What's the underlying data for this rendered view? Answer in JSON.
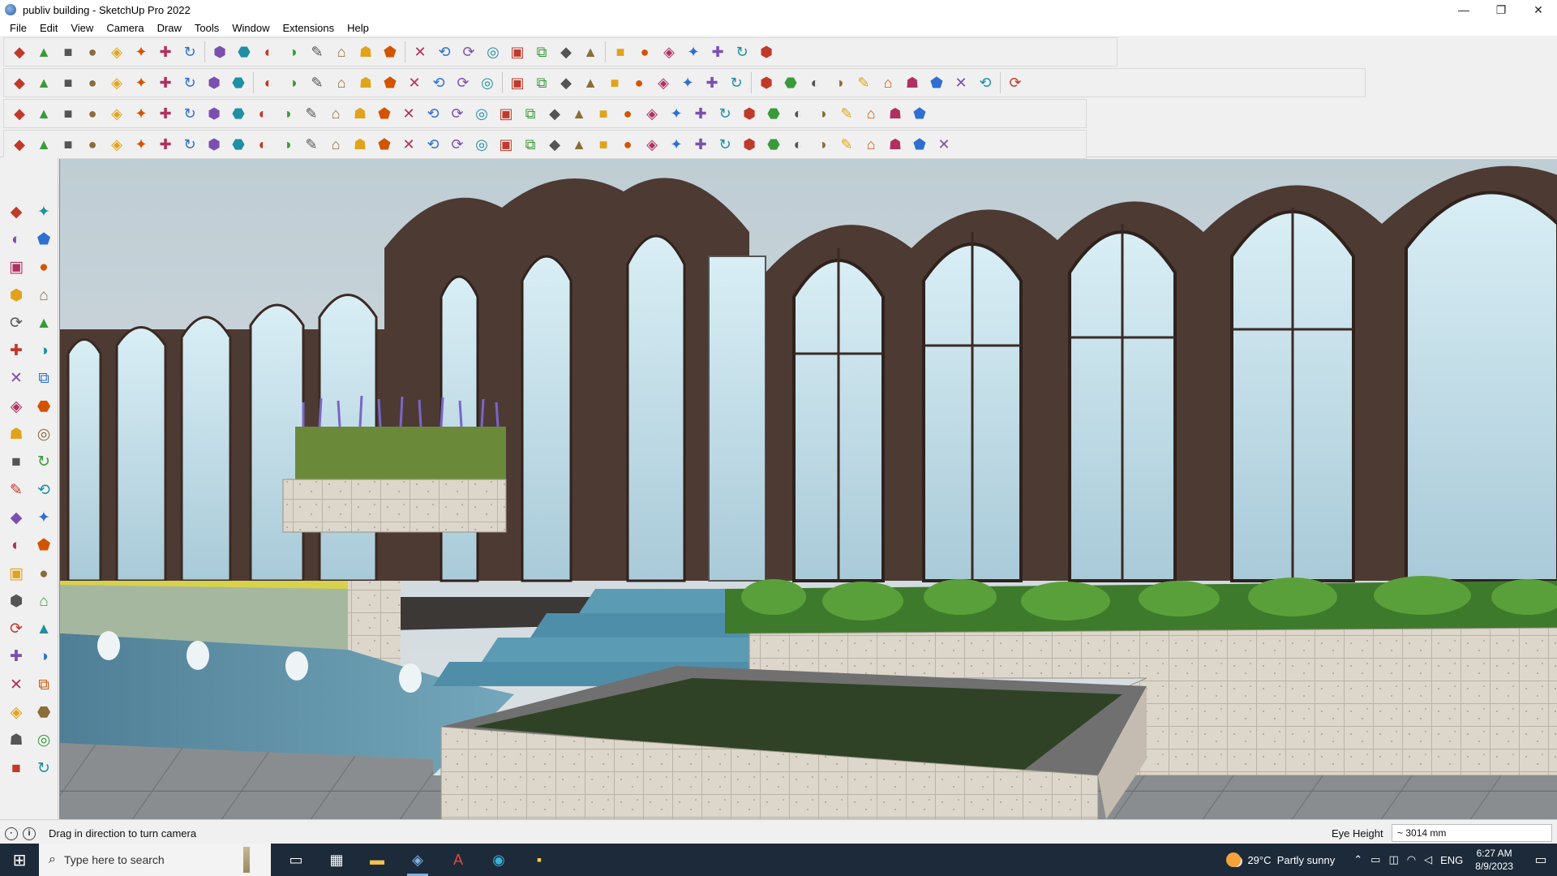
{
  "window": {
    "title": "publiv building - SketchUp Pro 2022",
    "controls": {
      "minimize": "—",
      "maximize": "❐",
      "close": "✕"
    }
  },
  "menu": [
    "File",
    "Edit",
    "View",
    "Camera",
    "Draw",
    "Tools",
    "Window",
    "Extensions",
    "Help"
  ],
  "toolbars": {
    "row1": [
      "zoom-extents-icon",
      "select-icon",
      "eraser-icon",
      "pencil-line-icon",
      "arc-icon",
      "rectangle-icon",
      "push-pull-icon",
      "follow-me-icon",
      "move-icon",
      "rotate-icon",
      "scale-icon",
      "tape-measure-icon",
      "text-icon",
      "paint-bucket-icon",
      "orbit-icon",
      "pan-icon",
      "zoom-icon",
      "zoom-window-icon",
      "section-plane-icon",
      "layers-icon",
      "outliner-icon",
      "styles-icon",
      "user-account-icon",
      "warehouse-icon",
      "extension-warehouse-icon",
      "flip-icon",
      "tag-icon",
      "sandbox-icon",
      "undo-icon",
      "redo-icon",
      "component-icon"
    ],
    "row2": [
      "cube-icon",
      "cube-x-ray-icon",
      "cube-wire-icon",
      "arrow-push-icon",
      "solid-union-icon",
      "solid-subtract-icon",
      "solid-intersect-icon",
      "solid-trim-icon",
      "solid-split-icon",
      "outer-shell-icon",
      "curve-icon",
      "section-fill-icon",
      "section-cut-icon",
      "section-display-icon",
      "terrain-icon",
      "smoove-icon",
      "house-icon",
      "door-icon",
      "home-icon",
      "home-outline-icon",
      "roof-icon",
      "fe-icon",
      "leaf-icon",
      "pencil-red-icon",
      "circle-icon",
      "polygon-icon",
      "ellipse-icon",
      "parallelogram-icon",
      "bezier-icon",
      "spline-icon",
      "loop-icon",
      "push-icon",
      "scale-red-icon",
      "diamond-icon",
      "shape-a-icon",
      "shape-b-icon",
      "shape-c-icon",
      "shape-d-icon",
      "shape-e-icon",
      "shape-f-icon",
      "shape-g-icon"
    ],
    "row3": [
      "plane-blue-icon",
      "plane-blue-2-icon",
      "plane-yellow-icon",
      "plane-green-icon",
      "plane-red-icon",
      "plane-white-icon",
      "curve-orange-icon",
      "square-red-icon",
      "grid-icon",
      "paper-icon",
      "box-icon",
      "corner-icon",
      "knot-icon",
      "add-red-icon",
      "add-green-icon",
      "cross-blue-icon",
      "drop-icon",
      "drop-2-icon",
      "warning-icon",
      "hook-icon",
      "bomb-icon",
      "rotate-black-icon",
      "move-blue-icon",
      "bin-icon",
      "undo-red-icon",
      "cubes-green-icon",
      "shape-h-icon",
      "shape-i-icon",
      "shape-j-icon",
      "gem-red-icon",
      "gear-multi-icon",
      "frame-icon",
      "texture-icon",
      "grid-orange-icon",
      "grid-orange-2-icon",
      "x-red-icon",
      "dots-icon",
      "panel-icon"
    ],
    "row4": [
      "path-icon",
      "dotted-curve-icon",
      "truck-icon",
      "knife-icon",
      "sprocket-icon",
      "cloud-icon",
      "pipe-icon",
      "box-tool-icon",
      "sphere-icon",
      "fan-icon",
      "stair-icon",
      "stair-2-icon",
      "slope-icon",
      "bridge-icon",
      "archway-icon",
      "tent-icon",
      "columns-icon",
      "columns-2-icon",
      "hand-icon",
      "leaf-2-icon",
      "arrow-left-icon",
      "stack-icon",
      "ramp-icon",
      "split-icon",
      "split-2-icon",
      "split-3-icon",
      "jelly-icon",
      "slash-icon",
      "pillar-icon",
      "pillar-2-icon",
      "hatch-icon",
      "hatch-2-icon",
      "hatch-3-icon",
      "comb-icon",
      "bug-icon",
      "bug-2-icon",
      "ridge-icon",
      "ridge-2-icon",
      "globe-tool-icon"
    ]
  },
  "left_toolbar": [
    "select-icon",
    "orbit-icon",
    "paint-icon",
    "eraser-icon",
    "component-icon",
    "tape-icon",
    "line-icon",
    "freehand-icon",
    "rect-icon",
    "rotated-rect-icon",
    "circle-icon",
    "polygon-icon",
    "arc-icon",
    "arc-2-icon",
    "pie-icon",
    "arc-3-icon",
    "move-icon",
    "push-pull-icon",
    "rotate-icon",
    "follow-me-icon",
    "scale-icon",
    "offset-icon",
    "tape-2-icon",
    "text-icon",
    "protractor-icon",
    "3d-text-icon",
    "axes-icon",
    "dimension-icon",
    "orbit-2-icon",
    "pan-icon",
    "zoom-icon",
    "zoom-window-icon",
    "zoom-extents-icon",
    "previous-icon",
    "walk-icon",
    "look-around-icon",
    "footprint-icon",
    "position-camera-icon",
    "section-icon",
    "section-2-icon",
    "layers-icon",
    "layers-2-icon"
  ],
  "status": {
    "message": "Drag in direction to turn camera",
    "eye_height_label": "Eye Height",
    "eye_height_value": "~ 3014 mm"
  },
  "taskbar": {
    "search_placeholder": "Type here to search",
    "weather_temp": "29°C",
    "weather_desc": "Partly sunny",
    "language": "ENG",
    "time": "6:27 AM",
    "date": "8/9/2023"
  },
  "colors": {
    "arch_brown": "#4d3a33",
    "glass": "#cfe6ef",
    "sky": "#c9d4da",
    "water": "#5d8aa0",
    "lawn": "#2f4226",
    "stone": "#d9d2c6"
  }
}
